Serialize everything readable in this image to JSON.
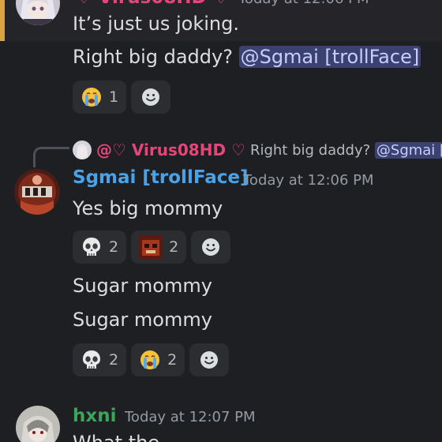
{
  "colors": {
    "background": "#1e1f22",
    "highlight": "#d9a441",
    "user_virus": "#e5467a",
    "user_sgmai": "#4aa3e8",
    "user_hxni": "#3ba55d"
  },
  "top_message": {
    "author_fragment": "♡ Virus08HD ♡",
    "timestamp_fragment": "Today at 12:06 PM",
    "line1": "It’s just us joking.",
    "line2_text": "Right big daddy? ",
    "line2_mention": "@Sgmai [trollFace]",
    "reactions": [
      {
        "emoji": "loudly-crying-face",
        "count": "1"
      }
    ]
  },
  "reply_message": {
    "reply_to": {
      "author": "@♡ Virus08HD ♡",
      "preview_text": "Right big daddy? ",
      "preview_mention": "@Sgmai ["
    },
    "author": "Sgmai [trollFace]",
    "timestamp": "Today at 12:06 PM",
    "line1": "Yes big mommy",
    "reactions1": [
      {
        "emoji": "skull",
        "count": "2"
      },
      {
        "emoji": "custom-troll",
        "count": "2"
      }
    ],
    "line2": "Sugar mommy",
    "line3": "Sugar mommy",
    "reactions2": [
      {
        "emoji": "skull",
        "count": "2"
      },
      {
        "emoji": "loudly-crying-face",
        "count": "2"
      }
    ]
  },
  "bottom_message": {
    "author": "hxni",
    "timestamp": "Today at 12:07 PM",
    "line1_fragment": "What the"
  }
}
